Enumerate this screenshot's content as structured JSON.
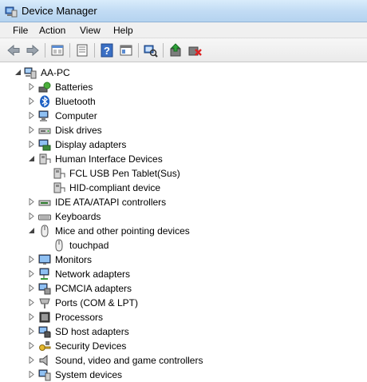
{
  "window": {
    "title": "Device Manager"
  },
  "menu": {
    "file": "File",
    "action": "Action",
    "view": "View",
    "help": "Help"
  },
  "toolbar": {
    "buttons": [
      "back-icon",
      "forward-icon",
      "up-level-icon",
      "properties-icon",
      "help-icon",
      "show-hide-icon",
      "scan-hardware-icon",
      "update-driver-icon",
      "uninstall-icon"
    ]
  },
  "tree": {
    "root": "AA-PC",
    "batteries": "Batteries",
    "bluetooth": "Bluetooth",
    "computer": "Computer",
    "disk_drives": "Disk drives",
    "display_adapters": "Display adapters",
    "human_interface_devices": "Human Interface Devices",
    "fcl_usb_pen_tablet": "FCL USB Pen Tablet(Sus)",
    "hid_compliant_device": "HID-compliant device",
    "ide_controllers": "IDE ATA/ATAPI controllers",
    "keyboards": "Keyboards",
    "mice": "Mice and other pointing devices",
    "touchpad": "touchpad",
    "monitors": "Monitors",
    "network_adapters": "Network adapters",
    "pcmcia_adapters": "PCMCIA adapters",
    "ports": "Ports (COM & LPT)",
    "processors": "Processors",
    "sd_host_adapters": "SD host adapters",
    "security_devices": "Security Devices",
    "sound": "Sound, video and game controllers",
    "system_devices": "System devices"
  }
}
